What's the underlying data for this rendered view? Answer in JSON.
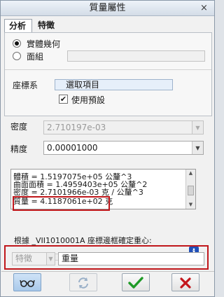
{
  "window": {
    "title": "質量屬性",
    "close_glyph": "×"
  },
  "tabs": [
    {
      "label": "分析"
    },
    {
      "label": "特徵"
    }
  ],
  "geometry": {
    "option_solid": "實體幾何",
    "option_quilt": "面組",
    "selected": "實體幾何"
  },
  "coord_system": {
    "label": "座標系",
    "field_value": "選取項目",
    "use_default_label": "使用預設",
    "use_default_checked": true
  },
  "density": {
    "label": "密度",
    "value": "2.710197e-03"
  },
  "accuracy": {
    "label": "精度",
    "value": "0.00001000"
  },
  "results": {
    "lines": [
      "體積 = 1.5197075e+05 公釐^3",
      "曲面面積 = 1.4959403e+05 公釐^2",
      "密度 = 2.7101966e-03 克 / 公釐^3",
      "質量 = 4.1187061e+02 克",
      "根據 _VII1010001A 座標邊框確定重心:"
    ]
  },
  "feature": {
    "type_label": "特徵",
    "name_value": "重量"
  },
  "buttons": {
    "glasses_icon": "glasses-icon",
    "repeat_icon": "repeat-icon",
    "ok_icon": "checkmark-icon",
    "cancel_icon": "cancel-x-icon"
  },
  "colors": {
    "highlight": "#c0171b",
    "ok_green": "#1e9a26",
    "cancel_red": "#c4161c",
    "info_blue": "#1f4fb8"
  }
}
